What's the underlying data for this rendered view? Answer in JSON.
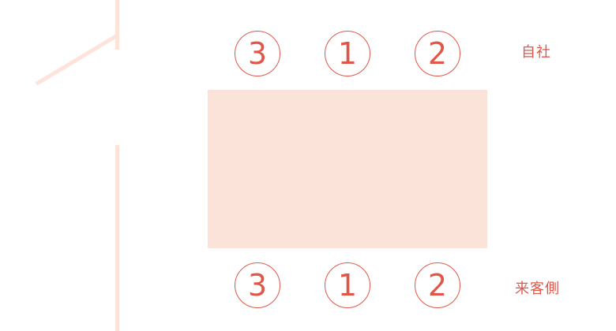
{
  "colors": {
    "accent": "#e0574a",
    "wall": "#fde3da",
    "table": "#fce3da",
    "background": "#ffffff"
  },
  "seats": {
    "host_side": [
      "3",
      "1",
      "2"
    ],
    "guest_side": [
      "3",
      "1",
      "2"
    ]
  },
  "labels": {
    "host_side": "自社",
    "guest_side": "来客側"
  }
}
